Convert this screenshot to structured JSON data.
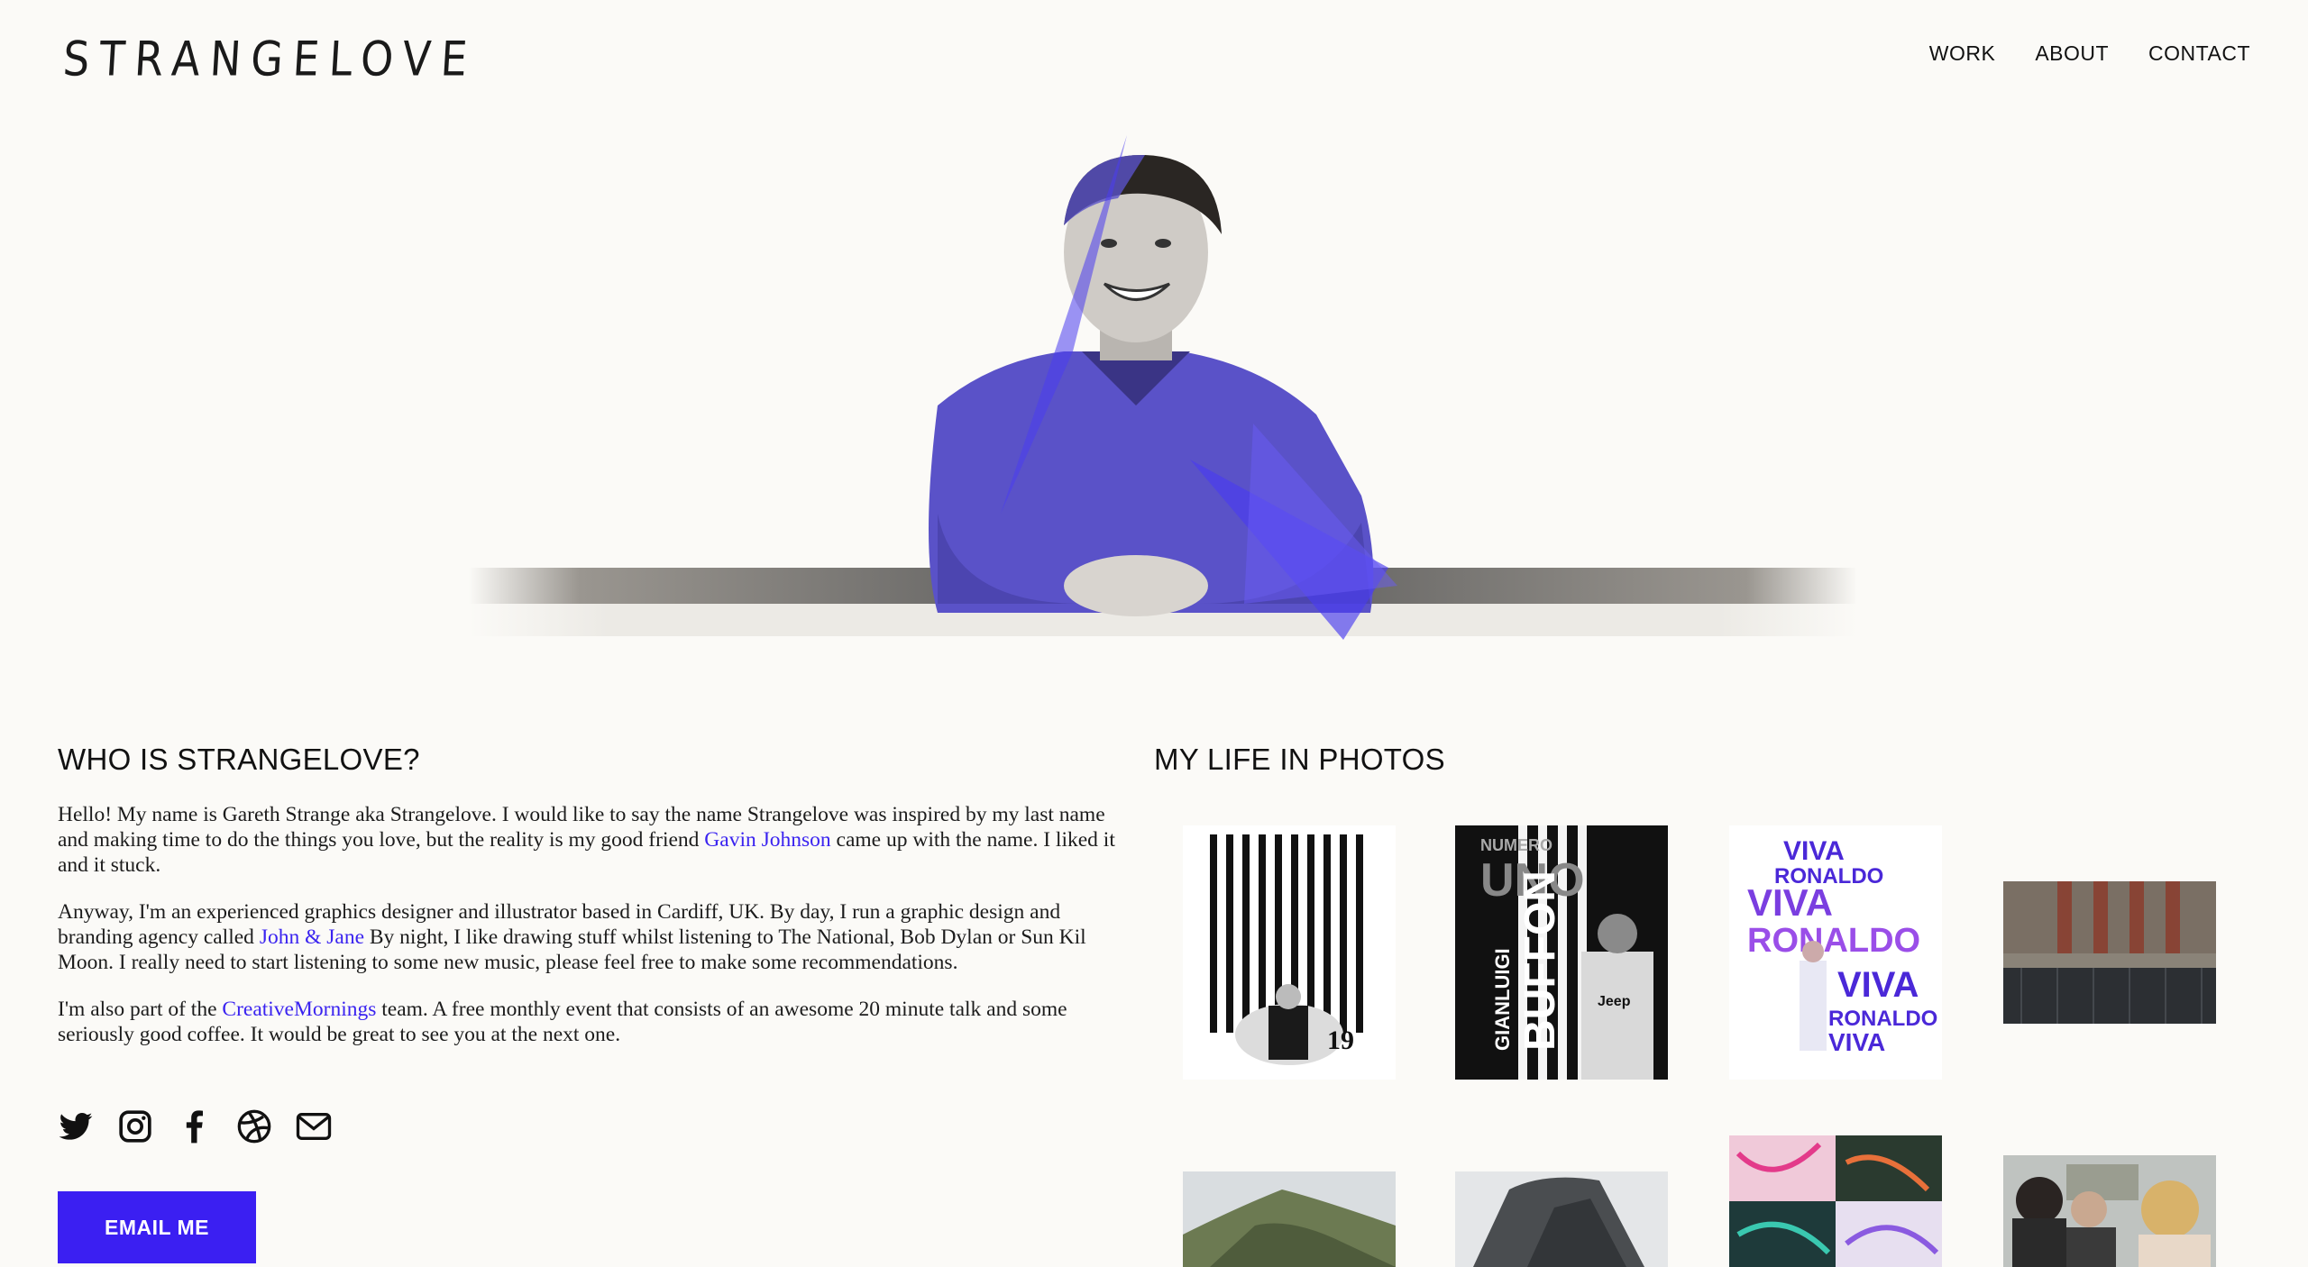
{
  "header": {
    "logo": "STRANGELOVE",
    "nav": [
      {
        "label": "WORK"
      },
      {
        "label": "ABOUT"
      },
      {
        "label": "CONTACT"
      }
    ]
  },
  "about": {
    "title": "WHO IS STRANGELOVE?",
    "p1_a": "Hello! My name is Gareth Strange aka Strangelove. I would like to say the name Strangelove was inspired by my last name and making time to do the things you love, but the reality is my good friend ",
    "p1_link": "Gavin Johnson",
    "p1_b": " came up with the name. I liked it and it stuck.",
    "p2_a": "Anyway, I'm an experienced graphics designer and illustrator based in Cardiff, UK. By day, I run a graphic design and branding agency called ",
    "p2_link": "John & Jane",
    "p2_b": " By night, I like drawing stuff whilst listening to The National, Bob Dylan or Sun Kil Moon. I really need to start listening to some new music, please feel free to make some recommendations.",
    "p3_a": "I'm also part of the ",
    "p3_link": "CreativeMornings",
    "p3_b": " team. A free monthly event that consists of an awesome 20 minute talk and some seriously good coffee. It would be great to see you at the next one.",
    "socials": [
      "twitter-icon",
      "instagram-icon",
      "facebook-icon",
      "dribbble-icon",
      "mail-icon"
    ],
    "email_button": "EMAIL ME"
  },
  "photos": {
    "title": "MY LIFE IN PHOTOS",
    "poster1": {
      "number": "19"
    },
    "poster2": {
      "line1": "NUMERO",
      "line2": "UNO",
      "name1": "GIANLUIGI",
      "name2": "BUFFON",
      "sponsor": "Jeep"
    },
    "poster3": {
      "word1": "VIVA",
      "word2": "RONALDO"
    }
  },
  "colors": {
    "accent": "#3b1ff2",
    "link": "#3a23f0",
    "background": "#fbfaf7"
  }
}
